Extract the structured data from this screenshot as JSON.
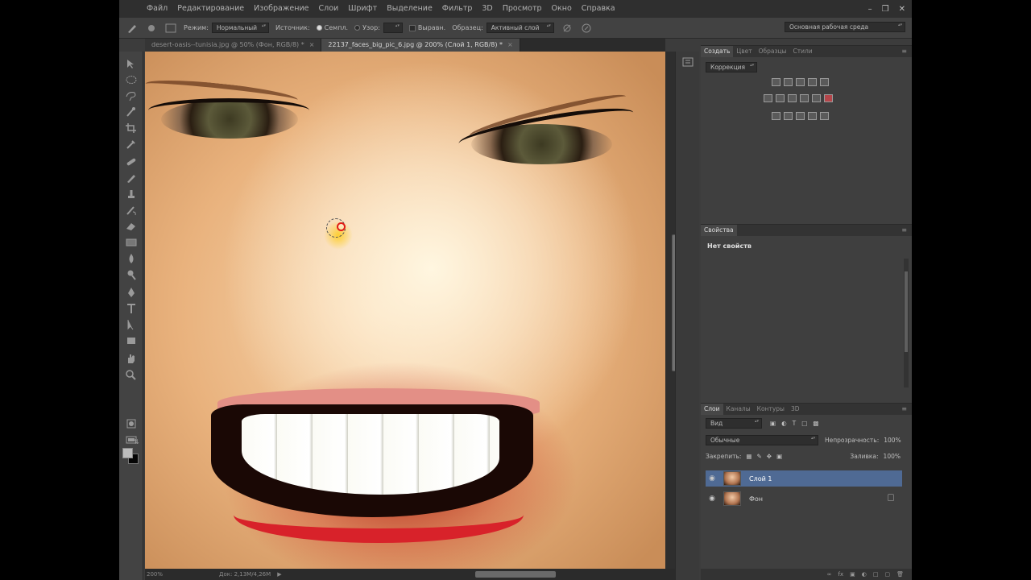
{
  "menu": {
    "items": [
      "Файл",
      "Редактирование",
      "Изображение",
      "Слои",
      "Шрифт",
      "Выделение",
      "Фильтр",
      "3D",
      "Просмотр",
      "Окно",
      "Справка"
    ]
  },
  "options": {
    "mode_label": "Режим:",
    "mode_value": "Нормальный",
    "source_label": "Источник:",
    "sampled_label": "Семпл.",
    "pattern_label": "Узор:",
    "aligned_label": "Выравн.",
    "sample_label": "Образец:",
    "sample_value": "Активный слой",
    "workspace": "Основная рабочая среда"
  },
  "tabs": [
    {
      "label": "desert-oasis--tunisia.jpg @ 50% (Фон, RGB/8) *",
      "active": false
    },
    {
      "label": "22137_faces_big_pic_6.jpg @ 200% (Слой 1, RGB/8) *",
      "active": true
    }
  ],
  "status": {
    "zoom": "200%",
    "doc": "Док: 2,13M/4,26M"
  },
  "adjustments": {
    "tabs": [
      "Создать",
      "Цвет",
      "Образцы",
      "Стили"
    ],
    "active_tab": 0,
    "preset_dropdown": "Коррекция"
  },
  "properties": {
    "tab": "Свойства",
    "empty_text": "Нет свойств"
  },
  "layers": {
    "tabs": [
      "Слои",
      "Каналы",
      "Контуры",
      "3D"
    ],
    "active_tab": 0,
    "filter_value": "Вид",
    "blend_mode": "Обычные",
    "opacity_label": "Непрозрачность:",
    "opacity_value": "100%",
    "lock_label": "Закрепить:",
    "fill_label": "Заливка:",
    "fill_value": "100%",
    "items": [
      {
        "name": "Слой 1",
        "active": true,
        "locked": false
      },
      {
        "name": "Фон",
        "active": false,
        "locked": true
      }
    ]
  },
  "colors": {
    "accent": "#4f6a94",
    "brush_cursor": "#e21d17",
    "foreground": "#bdbdbd",
    "background": "#050505"
  }
}
